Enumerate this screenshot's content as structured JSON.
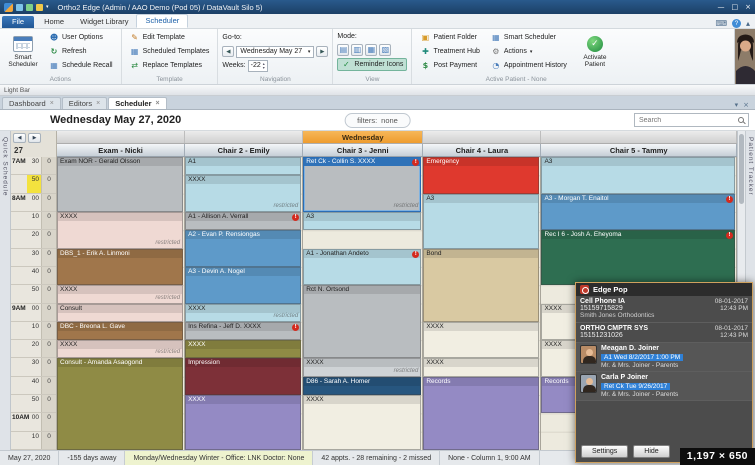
{
  "icons": {
    "prev": "◀",
    "next": "▶",
    "down": "▾",
    "up": "▴",
    "check": "✓",
    "close": "×",
    "minimize": "—",
    "restore": "□",
    "tab_close": "×",
    "help": "?",
    "keyboard": "⌨",
    "collapse": "▴",
    "refresh": "↻",
    "edit": "✎",
    "swap": "⇄",
    "user": "☻",
    "grid": "▦",
    "dollar": "$",
    "plus": "✚",
    "clock": "◔",
    "gear": "⚙",
    "folder": "▣",
    "alert": "!",
    "mode_glyphs": [
      "▤",
      "▥",
      "▦",
      "▧"
    ]
  },
  "titlebar": {
    "title": "Ortho2 Edge (Admin / AAO Demo (Pod 05) / DataVault Silo 5)"
  },
  "ribbon": {
    "file": "File",
    "tabs": [
      "Home",
      "Widget Library",
      "Scheduler"
    ],
    "smart_scheduler": "Smart Scheduler",
    "user_options": "User Options",
    "refresh": "Refresh",
    "schedule_recall": "Schedule Recall",
    "edit_template": "Edit Template",
    "scheduled_templates": "Scheduled Templates",
    "replace_templates": "Replace Templates",
    "goto_label": "Go-to:",
    "date_value": "Wednesday May 27",
    "weeks_label": "Weeks:",
    "weeks_value": "-22",
    "mode_label": "Mode:",
    "reminder_icons": "Reminder Icons",
    "patient_folder": "Patient Folder",
    "treatment_hub": "Treatment Hub",
    "post_payment": "Post Payment",
    "smart_scheduler_sm": "Smart Scheduler",
    "actions_btn": "Actions",
    "appointment_history": "Appointment History",
    "activate_patient": "Activate Patient",
    "grp_actions": "Actions",
    "grp_template": "Template",
    "grp_navigation": "Navigation",
    "grp_view": "View",
    "grp_active_patient": "Active Patient - None"
  },
  "lightbar": "Light Bar",
  "doc_tabs": [
    {
      "label": "Dashboard"
    },
    {
      "label": "Editors"
    },
    {
      "label": "Scheduler",
      "active": true
    }
  ],
  "toolbar": {
    "date_title": "Wednesday May 27, 2020",
    "filters_label": "filters:",
    "filters_value": "none",
    "search_placeholder": "Search"
  },
  "schedule": {
    "day_number": "27",
    "day_band": "Wednesday",
    "quick_schedule": "Quick Schedule",
    "patient_tracker": "Patient Tracker",
    "restricted_text": "restricted",
    "palette": {
      "gray": "#b9bdc0",
      "ltgray": "#cfd3d6",
      "lightblue": "#b7dbe6",
      "blue": "#5e9ac9",
      "pink": "#efd9d3",
      "brown": "#a0764b",
      "olive": "#8f8b45",
      "maroon": "#7d3038",
      "purple": "#948ac4",
      "red": "#df392e",
      "tan": "#d9c9a2",
      "ivory": "#f1eee2",
      "navy": "#27567f",
      "green": "#2e6e51"
    },
    "col_flex": [
      128,
      118,
      120,
      118,
      196
    ],
    "rows": [
      {
        "hour": "7AM",
        "min": "30",
        "count": "0"
      },
      {
        "min": "50",
        "count": "0",
        "highlight": true
      },
      {
        "hour": "8AM",
        "min": "00",
        "count": "0"
      },
      {
        "min": "10",
        "count": "0"
      },
      {
        "min": "20",
        "count": "0"
      },
      {
        "min": "30",
        "count": "0"
      },
      {
        "min": "40",
        "count": "0"
      },
      {
        "min": "50",
        "count": "0"
      },
      {
        "hour": "9AM",
        "min": "00",
        "count": "0"
      },
      {
        "min": "10",
        "count": "0"
      },
      {
        "min": "20",
        "count": "0"
      },
      {
        "min": "30",
        "count": "0"
      },
      {
        "min": "40",
        "count": "0"
      },
      {
        "min": "50",
        "count": "0"
      },
      {
        "hour": "10AM",
        "min": "00",
        "count": "0"
      },
      {
        "min": "10",
        "count": "0"
      }
    ],
    "columns": [
      {
        "name": "Exam - Nicki",
        "appts": [
          {
            "row": 0,
            "span": 3,
            "label": "Exam NOR - Gerald Olsson",
            "color": "gray"
          },
          {
            "row": 3,
            "span": 2,
            "label": "XXXX",
            "color": "pink",
            "restricted": true
          },
          {
            "row": 5,
            "span": 2,
            "label": "DBS_1 - Erik A. Linmoni",
            "color": "brown",
            "dark": true
          },
          {
            "row": 7,
            "span": 1,
            "label": "XXXX",
            "color": "pink",
            "restricted": true
          },
          {
            "row": 8,
            "span": 1,
            "label": "Consult",
            "color": "pink"
          },
          {
            "row": 9,
            "span": 1,
            "label": "DBC - Breona L. Gave",
            "color": "brown",
            "dark": true
          },
          {
            "row": 10,
            "span": 1,
            "label": "XXXX",
            "color": "pink",
            "restricted": true
          },
          {
            "row": 11,
            "span": 5,
            "label": "Consult - Amanda Asaogond",
            "color": "olive",
            "dark": true
          }
        ]
      },
      {
        "name": "Chair 2 - Emily",
        "appts": [
          {
            "row": 0,
            "span": 1,
            "label": "A1",
            "color": "lightblue"
          },
          {
            "row": 1,
            "span": 2,
            "label": "XXXX",
            "color": "lightblue",
            "restricted": true
          },
          {
            "row": 3,
            "span": 1,
            "label": "A1 - Allison A. Verrall",
            "color": "gray",
            "alert": true
          },
          {
            "row": 4,
            "span": 2,
            "label": "A2 - Evan P. Rensiongas",
            "color": "blue",
            "dark": true
          },
          {
            "row": 6,
            "span": 2,
            "label": "A3 - Devin A. Nogel",
            "color": "blue",
            "dark": true
          },
          {
            "row": 8,
            "span": 1,
            "label": "XXXX",
            "color": "lightblue",
            "restricted": true
          },
          {
            "row": 9,
            "span": 1,
            "label": "Ins Refina - Jeff D. XXXX",
            "color": "gray",
            "alert": true
          },
          {
            "row": 10,
            "span": 1,
            "label": "XXXX",
            "color": "olive",
            "dark": true
          },
          {
            "row": 11,
            "span": 2,
            "label": "Impression",
            "color": "maroon",
            "dark": true
          },
          {
            "row": 13,
            "span": 3,
            "label": "XXXX",
            "color": "purple",
            "dark": true
          }
        ]
      },
      {
        "name": "Chair 3 - Jenni",
        "appts": [
          {
            "row": 0,
            "span": 3,
            "label": "Ret Ck - Collin S. XXXX",
            "color": "gray",
            "selected": true,
            "restricted": true,
            "alert": true
          },
          {
            "row": 3,
            "span": 1,
            "label": "A3",
            "color": "lightblue"
          },
          {
            "row": 5,
            "span": 2,
            "label": "A1 - Jonathan Andeto",
            "color": "lightblue",
            "alert": true
          },
          {
            "row": 7,
            "span": 4,
            "label": "Rct N. Ortsond",
            "color": "gray"
          },
          {
            "row": 11,
            "span": 1,
            "label": "XXXX",
            "color": "ltgray",
            "restricted": true
          },
          {
            "row": 12,
            "span": 1,
            "label": "D86 - Sarah A. Homer",
            "color": "navy",
            "dark": true
          },
          {
            "row": 13,
            "span": 3,
            "label": "XXXX",
            "color": "ivory"
          }
        ]
      },
      {
        "name": "Chair 4 - Laura",
        "appts": [
          {
            "row": 0,
            "span": 2,
            "label": "Emergency",
            "color": "red",
            "dark": true
          },
          {
            "row": 2,
            "span": 3,
            "label": "A3",
            "color": "lightblue"
          },
          {
            "row": 5,
            "span": 4,
            "label": "Bond",
            "color": "tan"
          },
          {
            "row": 9,
            "span": 2,
            "label": "XXXX",
            "color": "ivory"
          },
          {
            "row": 11,
            "span": 1,
            "label": "XXXX",
            "color": "ivory"
          },
          {
            "row": 12,
            "span": 4,
            "label": "Records",
            "color": "purple",
            "dark": true
          }
        ]
      },
      {
        "name": "Chair 5 - Tammy",
        "appts": [
          {
            "row": 0,
            "span": 2,
            "label": "A3",
            "color": "lightblue"
          },
          {
            "row": 2,
            "span": 2,
            "label": "A3 - Morgan T. Enaitol",
            "color": "blue",
            "dark": true,
            "alert": true
          },
          {
            "row": 4,
            "span": 3,
            "label": "Rec I 6 - Josh A. Eheyoma",
            "color": "green",
            "dark": true,
            "alert": true
          },
          {
            "row": 8,
            "span": 2,
            "label": "XXXX",
            "color": "ivory",
            "half": true
          },
          {
            "row": 10,
            "span": 2,
            "label": "XXXX",
            "color": "ivory",
            "half": true
          },
          {
            "row": 12,
            "span": 2,
            "label": "Records",
            "color": "purple",
            "dark": true,
            "half": true
          }
        ]
      }
    ]
  },
  "status_bar": {
    "segments": [
      {
        "text": "May 27, 2020"
      },
      {
        "text": "-155 days away"
      },
      {
        "text": "Monday/Wednesday Winter -  Office: LNK  Doctor: None",
        "highlight": true
      },
      {
        "text": "42 appts. - 28 remaining - 2 missed"
      },
      {
        "text": "None - Column 1, 9:00 AM"
      }
    ]
  },
  "popup": {
    "title": "Edge Pop",
    "calls": [
      {
        "name": "Cell Phone   IA",
        "number": "15159715829",
        "org": "Smith Jones Orthodontics",
        "date": "08-01-2017",
        "time": "12:43 PM"
      },
      {
        "name": "ORTHO CMPTR SYS",
        "number": "15151231026",
        "org": "",
        "date": "08-01-2017",
        "time": "12:43 PM"
      }
    ],
    "patients": [
      {
        "name": "Meagan D. Joiner",
        "appt": "A1   Wed 8/2/2017  1:00 PM",
        "family": "Mr. & Mrs. Joiner - Parents"
      },
      {
        "name": "Carla P Joiner",
        "appt": "Ret Ck   Tue 9/26/2017",
        "family": "Mr. & Mrs. Joiner - Parents"
      }
    ],
    "settings": "Settings",
    "hide": "Hide"
  },
  "size_badge": "1,197 × 650"
}
